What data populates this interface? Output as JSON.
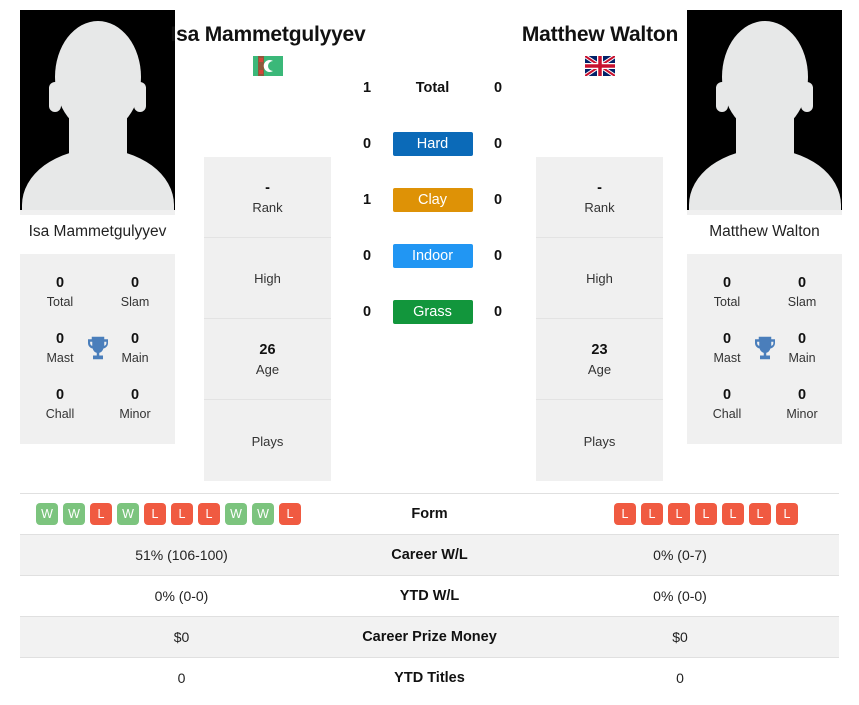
{
  "players": {
    "left": {
      "name_header": "Isa Mammetgulyyev",
      "name_under": "Isa Mammetgulyyev",
      "flag": "turkmenistan-flag",
      "titles": [
        {
          "value": "0",
          "label": "Total"
        },
        {
          "value": "0",
          "label": "Slam"
        },
        {
          "value": "0",
          "label": "Mast"
        },
        {
          "value": "0",
          "label": "Main"
        },
        {
          "value": "0",
          "label": "Chall"
        },
        {
          "value": "0",
          "label": "Minor"
        }
      ],
      "info": [
        {
          "value": "-",
          "label": "Rank"
        },
        {
          "value": "",
          "label": "High"
        },
        {
          "value": "26",
          "label": "Age"
        },
        {
          "value": "",
          "label": "Plays"
        }
      ],
      "form": [
        "W",
        "W",
        "L",
        "W",
        "L",
        "L",
        "L",
        "W",
        "W",
        "L"
      ]
    },
    "right": {
      "name_header": "Matthew Walton",
      "name_under": "Matthew Walton",
      "flag": "united-kingdom-flag",
      "titles": [
        {
          "value": "0",
          "label": "Total"
        },
        {
          "value": "0",
          "label": "Slam"
        },
        {
          "value": "0",
          "label": "Mast"
        },
        {
          "value": "0",
          "label": "Main"
        },
        {
          "value": "0",
          "label": "Chall"
        },
        {
          "value": "0",
          "label": "Minor"
        }
      ],
      "info": [
        {
          "value": "-",
          "label": "Rank"
        },
        {
          "value": "",
          "label": "High"
        },
        {
          "value": "23",
          "label": "Age"
        },
        {
          "value": "",
          "label": "Plays"
        }
      ],
      "form": [
        "L",
        "L",
        "L",
        "L",
        "L",
        "L",
        "L"
      ]
    }
  },
  "head_to_head": [
    {
      "label": "Total",
      "left": "1",
      "right": "0",
      "color": ""
    },
    {
      "label": "Hard",
      "left": "0",
      "right": "0",
      "color": "#0b6ab8"
    },
    {
      "label": "Clay",
      "left": "1",
      "right": "0",
      "color": "#de9206"
    },
    {
      "label": "Indoor",
      "left": "0",
      "right": "0",
      "color": "#2196f3"
    },
    {
      "label": "Grass",
      "left": "0",
      "right": "0",
      "color": "#12963c"
    }
  ],
  "comparison_rows": [
    {
      "label": "Form",
      "left": "",
      "right": ""
    },
    {
      "label": "Career W/L",
      "left": "51% (106-100)",
      "right": "0% (0-7)"
    },
    {
      "label": "YTD W/L",
      "left": "0% (0-0)",
      "right": "0% (0-0)"
    },
    {
      "label": "Career Prize Money",
      "left": "$0",
      "right": "$0"
    },
    {
      "label": "YTD Titles",
      "left": "0",
      "right": "0"
    }
  ],
  "colors": {
    "win": "#7cc47e",
    "loss": "#f05a41",
    "trophy": "#4a7ebb",
    "panel": "#f0f0f0"
  }
}
